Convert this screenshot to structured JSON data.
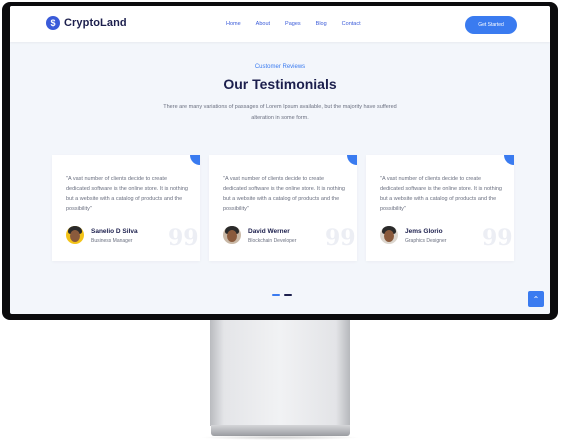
{
  "header": {
    "logo_symbol": "$",
    "logo_text": "CryptoLand",
    "nav": [
      "Home",
      "About",
      "Pages",
      "Blog",
      "Contact"
    ],
    "cta_label": "Get Started"
  },
  "section": {
    "eyebrow": "Customer Reviews",
    "title": "Our Testimonials",
    "intro": "There are many variations of passages of Lorem Ipsum available, but the majority have suffered alteration in some form."
  },
  "testimonials": [
    {
      "quote": "\"A vast number of clients decide to create dedicated software is the online store. It is nothing but a website with a catalog of products and the possibility\"",
      "name": "Sanelio D Silva",
      "role": "Business Manager"
    },
    {
      "quote": "\"A vast number of clients decide to create dedicated software is the online store. It is nothing but a website with a catalog of products and the possibility\"",
      "name": "David Werner",
      "role": "Blockchain Developer"
    },
    {
      "quote": "\"A vast number of clients decide to create dedicated software is the online store. It is nothing but a website with a catalog of products and the possibility\"",
      "name": "Jems Glorio",
      "role": "Graphics Designer"
    }
  ],
  "quote_glyph": "99",
  "to_top_icon": "arrow-up-icon",
  "to_top_glyph": "⌃",
  "colors": {
    "accent": "#3a7bf0",
    "heading": "#1c1f4d",
    "background": "#f3f6fb"
  }
}
